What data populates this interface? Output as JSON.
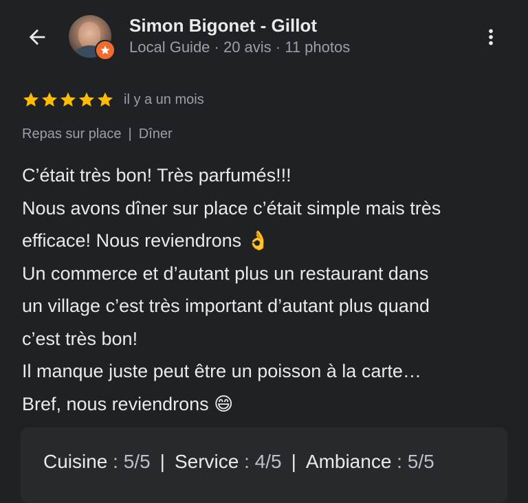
{
  "header": {
    "back_icon": "arrow-left-icon",
    "user_name": "Simon Bigonet - Gillot",
    "user_meta": "Local Guide · 20 avis · 11 photos",
    "more_icon": "more-vertical-icon",
    "badge_icon": "local-guide-badge-icon"
  },
  "review": {
    "rating": 5,
    "max_rating": 5,
    "time": "il y a un mois",
    "tags": [
      "Repas sur place",
      "Dîner"
    ],
    "tag_separator": "|",
    "lines": [
      "C’était très bon! Très parfumés!!!",
      "Nous avons dîner sur place c’était simple mais très",
      "efficace! Nous reviendrons 👌",
      "Un commerce et d’autant plus un restaurant dans",
      "un village c’est très important d’autant plus quand",
      "c’est très bon!",
      "Il manque juste peut être un poisson à la carte…",
      "Bref, nous reviendrons 😄"
    ]
  },
  "scores": [
    {
      "label": "Cuisine",
      "value": "5/5"
    },
    {
      "label": "Service",
      "value": "4/5"
    },
    {
      "label": "Ambiance",
      "value": "5/5"
    }
  ],
  "colors": {
    "background": "#202124",
    "star": "#fbbc04",
    "badge": "#ef6c2f",
    "muted_text": "#9aa0a6"
  }
}
